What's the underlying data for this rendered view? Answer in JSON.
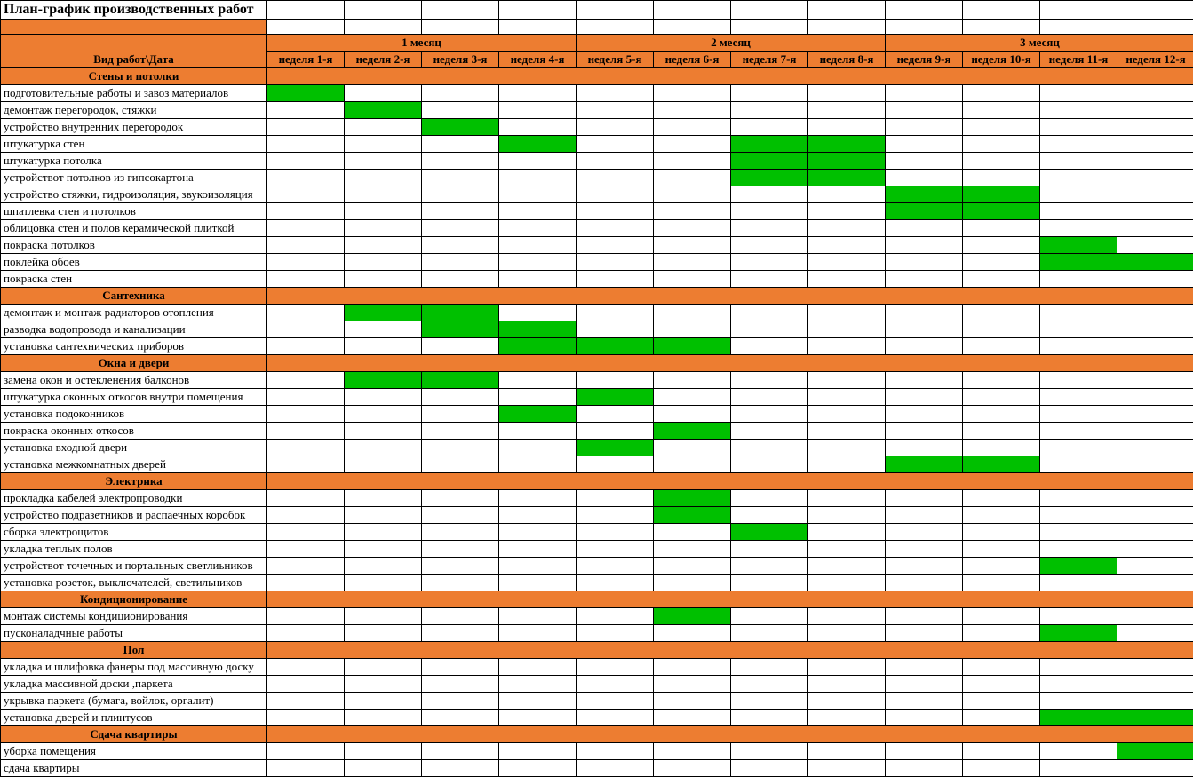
{
  "title": "План-график производственных работ",
  "row_header": "Вид работ\\Дата",
  "months": [
    "1 месяц",
    "2 месяц",
    "3 месяц"
  ],
  "weeks": [
    "неделя 1-я",
    "неделя 2-я",
    "неделя 3-я",
    "неделя 4-я",
    "неделя 5-я",
    "неделя 6-я",
    "неделя 7-я",
    "неделя 8-я",
    "неделя 9-я",
    "неделя 10-я",
    "неделя 11-я",
    "неделя 12-я"
  ],
  "sections": [
    {
      "name": "Стены и потолки",
      "rows": [
        {
          "task": "подготовительные работы и завоз материалов",
          "weeks": [
            1
          ]
        },
        {
          "task": "демонтаж перегородок, стяжки",
          "weeks": [
            2
          ]
        },
        {
          "task": "устройство внутренних перегородок",
          "weeks": [
            3
          ]
        },
        {
          "task": "штукатурка стен",
          "weeks": [
            4,
            7,
            8
          ]
        },
        {
          "task": "штукатурка потолка",
          "weeks": [
            7,
            8
          ]
        },
        {
          "task": "устройствот потолков из гипсокартона",
          "weeks": [
            7,
            8
          ]
        },
        {
          "task": "устройство стяжки, гидроизоляция, звукоизоляция",
          "weeks": [
            9,
            10
          ]
        },
        {
          "task": "шпатлевка стен и потолков",
          "weeks": [
            9,
            10
          ]
        },
        {
          "task": "облицовка стен и полов керамической плиткой",
          "weeks": []
        },
        {
          "task": "покраска потолков",
          "weeks": [
            11
          ]
        },
        {
          "task": "поклейка обоев",
          "weeks": [
            11,
            12
          ]
        },
        {
          "task": "покраска стен",
          "weeks": []
        }
      ]
    },
    {
      "name": "Сантехника",
      "rows": [
        {
          "task": "демонтаж и монтаж радиаторов отопления",
          "weeks": [
            2,
            3
          ]
        },
        {
          "task": "разводка водопровода и канализации",
          "weeks": [
            3,
            4
          ]
        },
        {
          "task": "установка сантехнических приборов",
          "weeks": [
            4,
            5,
            6
          ]
        }
      ]
    },
    {
      "name": "Окна и двери",
      "rows": [
        {
          "task": "замена окон и остекленения балконов",
          "weeks": [
            2,
            3
          ]
        },
        {
          "task": "штукатурка оконных откосов внутри помещения",
          "weeks": [
            5
          ]
        },
        {
          "task": "установка подоконников",
          "weeks": [
            4
          ]
        },
        {
          "task": "покраска оконных откосов",
          "weeks": [
            6
          ]
        },
        {
          "task": "установка входной двери",
          "weeks": [
            5
          ]
        },
        {
          "task": "установка межкомнатных дверей",
          "weeks": [
            9,
            10
          ]
        }
      ]
    },
    {
      "name": "Электрика",
      "rows": [
        {
          "task": "прокладка кабелей электропроводки",
          "weeks": [
            6
          ]
        },
        {
          "task": "устройство подразетников и распаечных коробок",
          "weeks": [
            6
          ]
        },
        {
          "task": "сборка электрощитов",
          "weeks": [
            7
          ]
        },
        {
          "task": "укладка теплых полов",
          "weeks": []
        },
        {
          "task": "устройствот точечных и портальных светлиьников",
          "weeks": [
            11
          ]
        },
        {
          "task": "установка розеток, выключателей, светильников",
          "weeks": []
        }
      ]
    },
    {
      "name": "Кондиционирование",
      "rows": [
        {
          "task": "монтаж системы кондиционирования",
          "weeks": [
            6
          ]
        },
        {
          "task": "пусконаладчные работы",
          "weeks": [
            11
          ]
        }
      ]
    },
    {
      "name": "Пол",
      "rows": [
        {
          "task": "укладка и шлифовка фанеры под массивную доску",
          "weeks": []
        },
        {
          "task": "укладка массивной доски ,паркета",
          "weeks": []
        },
        {
          "task": "укрывка паркета (бумага, войлок, оргалит)",
          "weeks": []
        },
        {
          "task": "установка дверей и плинтусов",
          "weeks": [
            11,
            12
          ]
        }
      ]
    },
    {
      "name": "Сдача квартиры",
      "rows": [
        {
          "task": "уборка помещения",
          "weeks": [
            12
          ]
        },
        {
          "task": "сдача квартиры",
          "weeks": []
        }
      ]
    }
  ]
}
